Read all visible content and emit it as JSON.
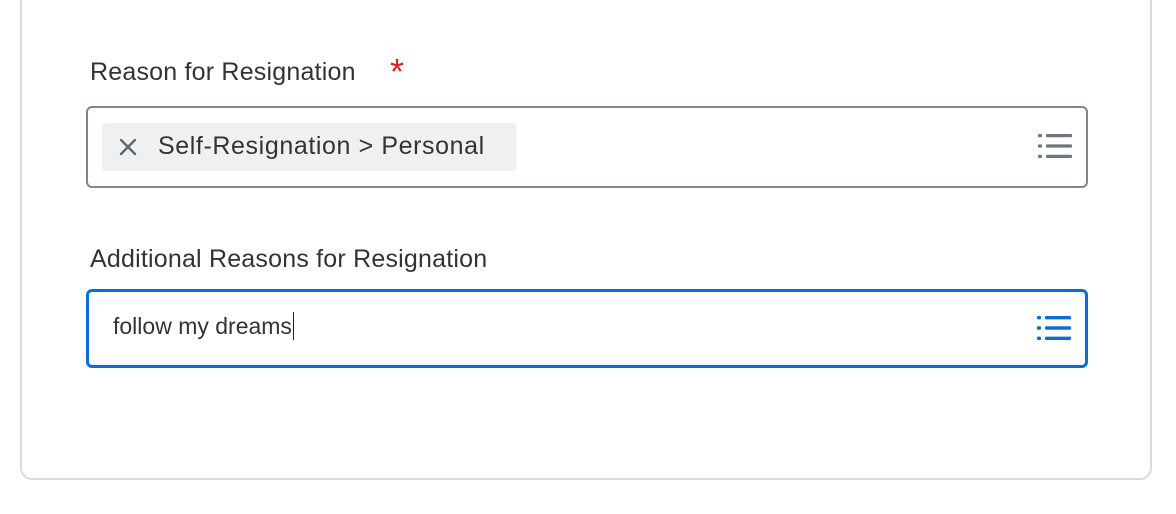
{
  "reason_field": {
    "label": "Reason for Resignation",
    "required_marker": "*",
    "selected_value": "Self-Resignation > Personal",
    "remove_icon": "close-icon",
    "prompt_icon": "list-icon"
  },
  "additional_field": {
    "label": "Additional Reasons for Resignation",
    "value": "follow my dreams",
    "prompt_icon": "list-icon",
    "state": "focused"
  },
  "colors": {
    "required": "#e02020",
    "focus_border": "#0b6ed4",
    "default_border": "#7b8593",
    "pill_background": "#eef0f2",
    "prompt_icon_default": "#6c7582",
    "prompt_icon_active": "#0b6ed4"
  }
}
